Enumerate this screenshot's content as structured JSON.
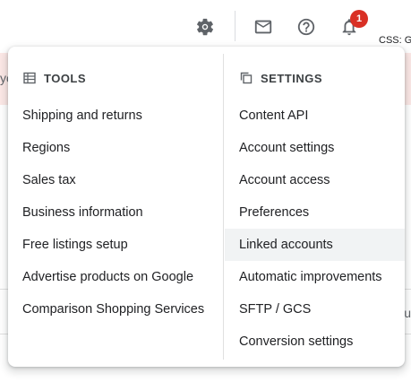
{
  "topbar": {
    "icons": [
      "gear-icon",
      "mail-icon",
      "help-icon",
      "notifications-icon"
    ],
    "notification_count": "1",
    "css_label": "CSS: G"
  },
  "background": {
    "banner_fragment": "yo",
    "row_fragment": "u"
  },
  "menu": {
    "tools": {
      "header": "TOOLS",
      "icon": "table-icon",
      "items": [
        "Shipping and returns",
        "Regions",
        "Sales tax",
        "Business information",
        "Free listings setup",
        "Advertise products on Google",
        "Comparison Shopping Services"
      ]
    },
    "settings": {
      "header": "SETTINGS",
      "icon": "copy-icon",
      "items": [
        "Content API",
        "Account settings",
        "Account access",
        "Preferences",
        "Linked accounts",
        "Automatic improvements",
        "SFTP / GCS",
        "Conversion settings"
      ],
      "highlighted": "Linked accounts"
    }
  },
  "colors": {
    "banner": "#fce8e6",
    "badge": "#d93025",
    "highlight": "#f1f3f4"
  }
}
